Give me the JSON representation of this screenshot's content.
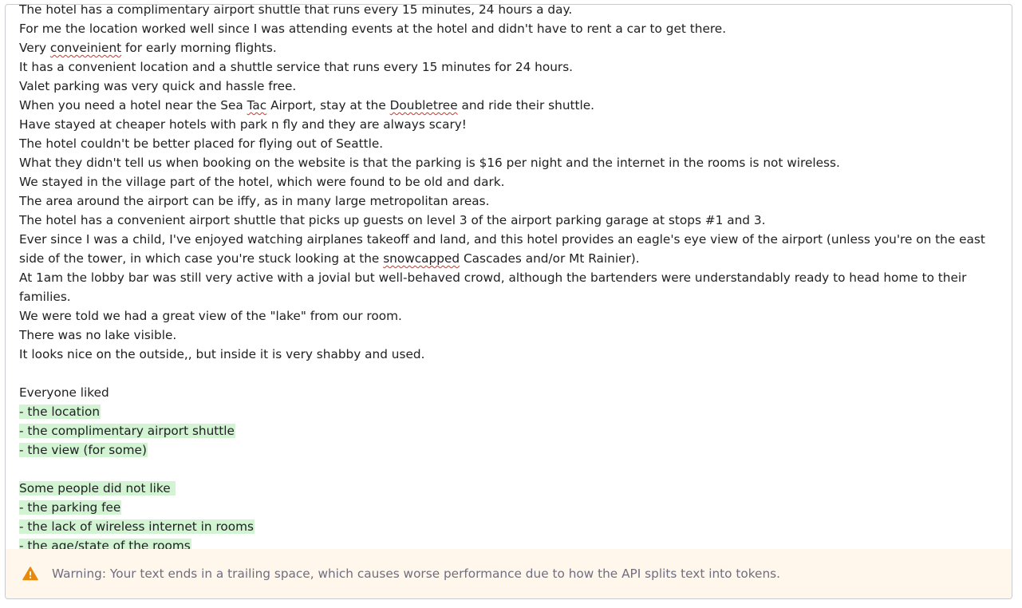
{
  "editor": {
    "lines": [
      "The hotel has a complimentary airport shuttle that runs every 15 minutes, 24 hours a day.",
      "For me the location worked well since I was attending events at the hotel and didn't have to rent a car to get there.",
      [
        "Very ",
        "conveinient",
        " for early morning flights."
      ],
      "It has a convenient location and a shuttle service that runs every 15 minutes for 24 hours.",
      "Valet parking was very quick and hassle free.",
      [
        "When you need a hotel near the Sea ",
        "Tac",
        " Airport, stay at the ",
        "Doubletree",
        " and ride their shuttle."
      ],
      "Have stayed at cheaper hotels with park n fly and they are always scary!",
      "The hotel couldn't be better placed for flying out of Seattle.",
      "What they didn't tell us when booking on the website is that the parking is $16 per night and the internet in the rooms is not wireless.",
      "We stayed in the village part of the hotel, which were found to be old and dark.",
      "The area around the airport can be iffy, as in many large metropolitan areas.",
      "The hotel has a convenient airport shuttle that picks up guests on level 3 of the airport parking garage at stops #1 and 3.",
      [
        "Ever since I was a child, I've enjoyed watching airplanes takeoff and land, and this hotel provides an eagle's eye view of the airport (unless you're on the east side of the tower, in which case you're stuck looking at the ",
        "snowcapped",
        " Cascades and/or Mt Rainier)."
      ],
      "At 1am the lobby bar was still very active with a jovial but well-behaved crowd, although the bartenders were understandably ready to head home to their families.",
      "We were told we had a great view of the \"lake\" from our room.",
      "There was no lake visible.",
      "It looks nice on the outside,, but inside it is very shabby and used.",
      "",
      "Everyone liked"
    ],
    "liked": [
      "- the location",
      "- the complimentary airport shuttle",
      "- the view (for some)"
    ],
    "disliked_heading": "Some people did not like ",
    "disliked": [
      "- the parking fee",
      "- the lack of wireless internet in rooms",
      "- the age/state of the rooms"
    ]
  },
  "warning": {
    "icon": "warning-triangle-icon",
    "color": "#e8890c",
    "background": "#fff7ec",
    "text": "Warning: Your text ends in a trailing space, which causes worse performance due to how the API splits text into tokens."
  },
  "colors": {
    "highlight": "#d2f4d3",
    "text": "#202123",
    "spellcheck": "#d93025"
  }
}
